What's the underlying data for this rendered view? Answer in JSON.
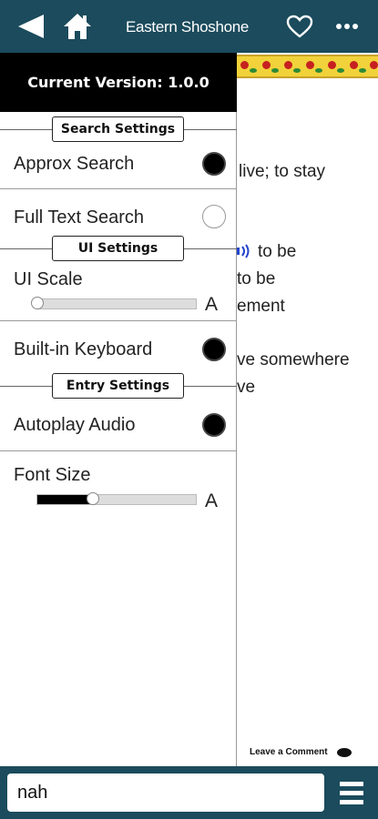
{
  "header": {
    "title": "Eastern Shoshone",
    "back_icon": "back-arrow-icon",
    "home_icon": "home-icon",
    "favorite_icon": "heart-icon",
    "more_icon": "more-dots-icon"
  },
  "background_entry": {
    "lines": [
      "live; to stay",
      "to be",
      "to be",
      "ement",
      "ve somewhere",
      "ve"
    ],
    "comment_label": "Leave a Comment"
  },
  "drawer": {
    "version": "Current Version: 1.0.0",
    "sections": {
      "search": "Search Settings",
      "ui": "UI Settings",
      "entry": "Entry Settings"
    },
    "settings": {
      "approx_search": {
        "label": "Approx Search",
        "selected": true
      },
      "full_text_search": {
        "label": "Full Text Search",
        "selected": false
      },
      "ui_scale": {
        "label": "UI Scale",
        "value": 0.0,
        "end_label": "A"
      },
      "builtin_keyboard": {
        "label": "Built-in Keyboard",
        "selected": true
      },
      "autoplay_audio": {
        "label": "Autoplay Audio",
        "selected": true
      },
      "font_size": {
        "label": "Font Size",
        "value": 0.35,
        "end_label": "A"
      }
    }
  },
  "search": {
    "value": "nah",
    "menu_icon": "hamburger-menu-icon"
  },
  "colors": {
    "bar": "#1b4b5c",
    "drawer_header": "#000000",
    "floral_band": "#f1d23a"
  }
}
